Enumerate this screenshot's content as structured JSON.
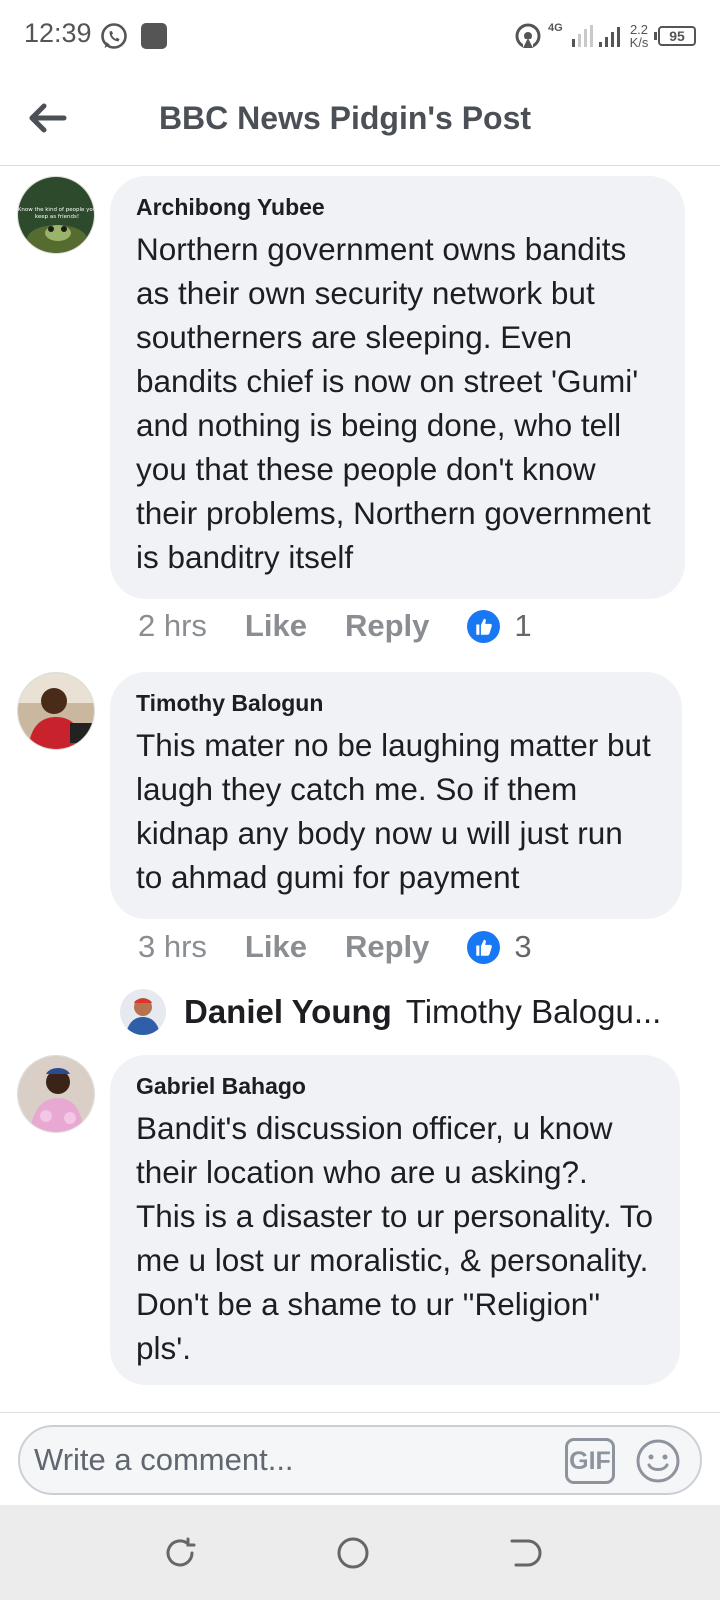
{
  "status_bar": {
    "time": "12:39",
    "network": "4G",
    "speed": "2.2",
    "speed_unit": "K/s",
    "battery": "95"
  },
  "header": {
    "title": "BBC News Pidgin's Post"
  },
  "comments": [
    {
      "author": "Archibong Yubee",
      "text": "Northern government owns bandits as their own security network but southerners are sleeping. Even bandits chief is now on street 'Gumi' and nothing is being done, who tell you that these people don't know their problems, Northern government is banditry itself",
      "time": "2 hrs",
      "like": "Like",
      "reply": "Reply",
      "reactions": "1",
      "avatar_text": "Know the kind of people you keep as friends!"
    },
    {
      "author": "Timothy Balogun",
      "text": "This mater no be laughing matter but laugh they catch me. So if them kidnap any body now u will just run to ahmad gumi for payment",
      "time": "3 hrs",
      "like": "Like",
      "reply": "Reply",
      "reactions": "3"
    },
    {
      "author": "Gabriel Bahago",
      "text": "Bandit's discussion officer, u know their location who are u asking?. This is a disaster to ur personality. To me u lost ur moralistic, & personality. Don't be a shame to ur ''Religion'' pls'."
    }
  ],
  "reply_preview": {
    "author": "Daniel Young",
    "snippet": "Timothy Balogu..."
  },
  "composer": {
    "placeholder": "Write a comment...",
    "gif_label": "GIF"
  },
  "colors": {
    "like_blue": "#1877f2",
    "bubble_bg": "#f0f2f5",
    "muted_text": "#8a8d91"
  },
  "icons": [
    "whatsapp-icon",
    "notification-square-icon",
    "hotspot-icon",
    "signal-icon",
    "battery-icon",
    "back-arrow-icon",
    "thumbs-up-icon",
    "emoji-icon",
    "recents-icon",
    "home-icon",
    "back-nav-icon"
  ]
}
